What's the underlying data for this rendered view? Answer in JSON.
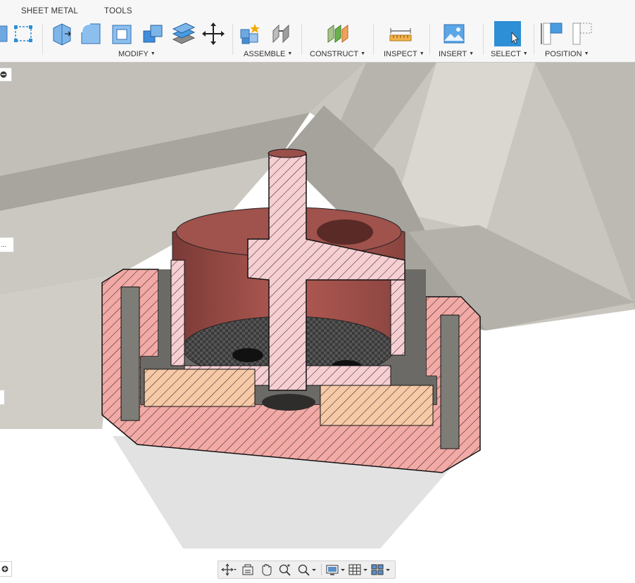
{
  "tabs": [
    {
      "label": "SHEET METAL"
    },
    {
      "label": "TOOLS"
    }
  ],
  "groups": {
    "modify": {
      "label": "MODIFY"
    },
    "assemble": {
      "label": "ASSEMBLE"
    },
    "construct": {
      "label": "CONSTRUCT"
    },
    "inspect": {
      "label": "INSPECT"
    },
    "insert": {
      "label": "INSERT"
    },
    "select": {
      "label": "SELECT"
    },
    "position": {
      "label": "POSITION"
    }
  },
  "side_tabs": {
    "middle": "..."
  },
  "colors": {
    "accent": "#2d8fd5",
    "section_hatch": "#f2a9a5",
    "section_hatch_orange": "#f6c7a5",
    "body_face": "#b85b55",
    "part_gray": "#c9c6bf"
  },
  "icons": {
    "modify": [
      "press-pull-icon",
      "fillet-icon",
      "shell-icon",
      "combine-icon",
      "offset-face-icon",
      "move-icon"
    ],
    "assemble": [
      "new-component-icon",
      "joint-icon"
    ],
    "construct": [
      "midplane-icon"
    ],
    "inspect": [
      "measure-icon"
    ],
    "insert": [
      "insert-image-icon"
    ],
    "select": [
      "select-cursor-icon"
    ],
    "position": [
      "capture-position-icon",
      "revert-position-icon"
    ],
    "nav": [
      "orbit-icon",
      "look-at-icon",
      "pan-icon",
      "zoom-icon",
      "fit-icon",
      "display-settings-icon",
      "grid-settings-icon",
      "viewports-icon"
    ]
  }
}
